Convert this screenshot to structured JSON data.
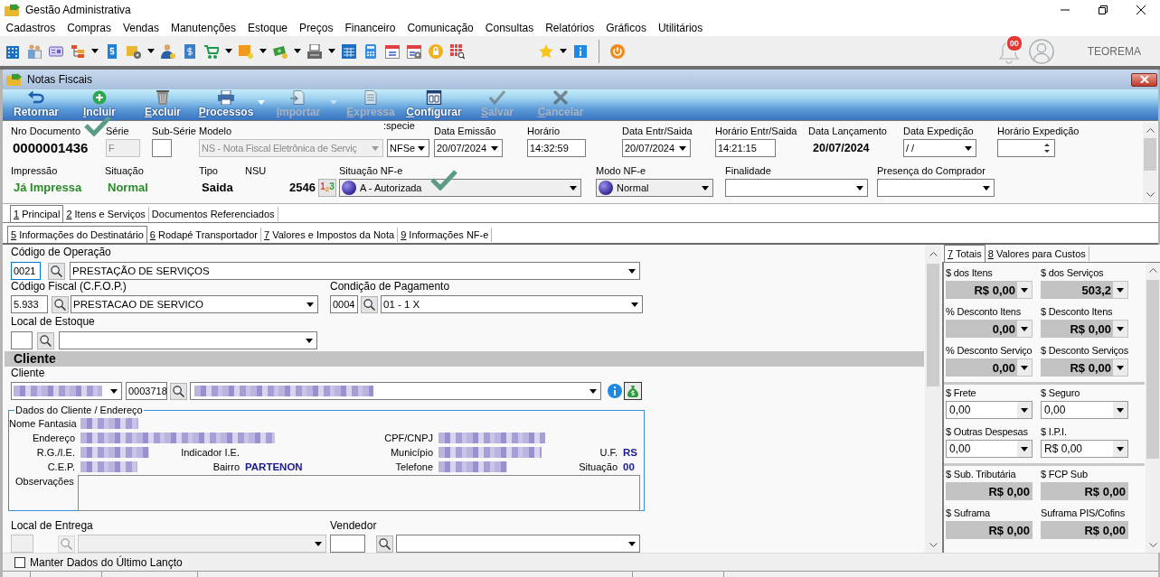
{
  "window": {
    "title": "Gestão Administrativa"
  },
  "menu": [
    "Cadastros",
    "Compras",
    "Vendas",
    "Manutenções",
    "Estoque",
    "Preços",
    "Financeiro",
    "Comunicação",
    "Consultas",
    "Relatórios",
    "Gráficos",
    "Utilitários"
  ],
  "user": {
    "notifications": "00",
    "name": "TEOREMA"
  },
  "form_window": {
    "title": "Notas Fiscais"
  },
  "actions": [
    {
      "label": "Retornar",
      "hotkey": false,
      "disabled": false,
      "has_menu": false
    },
    {
      "label": "Incluir",
      "hotkey": true,
      "disabled": false,
      "has_menu": false
    },
    {
      "label": "Excluir",
      "hotkey": true,
      "disabled": false,
      "has_menu": false
    },
    {
      "label": "Processos",
      "hotkey": true,
      "disabled": false,
      "has_menu": true
    },
    {
      "label": "Importar",
      "hotkey": true,
      "disabled": true,
      "has_menu": true
    },
    {
      "label": "Expressa",
      "hotkey": true,
      "disabled": true,
      "has_menu": false
    },
    {
      "label": "Configurar",
      "hotkey": true,
      "disabled": false,
      "has_menu": false
    },
    {
      "label": "Salvar",
      "hotkey": true,
      "disabled": true,
      "has_menu": false
    },
    {
      "label": "Cancelar",
      "hotkey": true,
      "disabled": true,
      "has_menu": false
    }
  ],
  "header": {
    "nro_documento": {
      "label": "Nro Documento",
      "value": "0000001436"
    },
    "serie": {
      "label": "Série",
      "value": "F",
      "disabled": true
    },
    "sub_serie": {
      "label": "Sub-Série",
      "disabled": false
    },
    "modelo": {
      "label": "Modelo",
      "value": "NS - Nota Fiscal Eletrônica de Serviç",
      "disabled": true
    },
    "especie": {
      "label": ":specie",
      "value": "NFSe"
    },
    "data_emissao": {
      "label": "Data Emissão",
      "value": "20/07/2024"
    },
    "horario": {
      "label": "Horário",
      "value": "14:32:59"
    },
    "data_entr_saida": {
      "label": "Data Entr/Saida",
      "value": "20/07/2024"
    },
    "horario_entr_saida": {
      "label": "Horário Entr/Saida",
      "value": "14:21:15"
    },
    "data_lancamento": {
      "label": "Data Lançamento",
      "value": "20/07/2024"
    },
    "data_expedicao": {
      "label": "Data Expedição",
      "value": "/ /"
    },
    "horario_expedicao": {
      "label": "Horário Expedição"
    },
    "impressao": {
      "label": "Impressão",
      "value": "Já Impressa"
    },
    "situacao": {
      "label": "Situação",
      "value": "Normal"
    },
    "tipo": {
      "label": "Tipo",
      "value": "Saida"
    },
    "nsu": {
      "label": "NSU",
      "value": "2546",
      "button": "1$_{2}$3"
    },
    "situacao_nfe": {
      "label": "Situação NF-e",
      "value": "A - Autorizada"
    },
    "modo_nfe": {
      "label": "Modo NF-e",
      "value": "Normal"
    },
    "finalidade": {
      "label": "Finalidade"
    },
    "presenca_comprador": {
      "label": "Presença do Comprador"
    }
  },
  "tabs": [
    {
      "label": "1 Principal",
      "selected": true,
      "hotkey": true
    },
    {
      "label": "2 Itens e Serviços",
      "selected": false,
      "hotkey": true
    },
    {
      "label": "Documentos Referenciados",
      "selected": false,
      "hotkey": false
    }
  ],
  "subtabs": [
    {
      "label": "5 Informações do Destinatário",
      "selected": true,
      "hotkey": true
    },
    {
      "label": "6 Rodapé Transportador",
      "selected": false,
      "hotkey": true
    },
    {
      "label": "7 Valores e Impostos da Nota",
      "selected": false,
      "hotkey": true
    },
    {
      "label": "9 Informações NF-e",
      "selected": false,
      "hotkey": true
    }
  ],
  "operacao": {
    "label": "Código de Operação",
    "code": "0021",
    "description": "PRESTAÇÃO DE SERVIÇOS"
  },
  "cfop": {
    "label": "Código Fiscal (C.F.O.P.)",
    "code": "5.933",
    "description": "PRESTACAO DE SERVICO"
  },
  "pagamento": {
    "label": "Condição de Pagamento",
    "code": "0004",
    "description": "01 - 1 X"
  },
  "local_estoque": {
    "label": "Local de Estoque"
  },
  "cliente_section": {
    "title": "Cliente"
  },
  "cliente": {
    "label": "Cliente",
    "type_redacted": true,
    "code": "0003718",
    "name_redacted": true
  },
  "client_data": {
    "title": "Dados do Cliente / Endereço",
    "nome_fantasia": {
      "label": "Nome Fantasia",
      "redacted": true
    },
    "endereco": {
      "label": "Endereço",
      "redacted": true
    },
    "cpf_cnpj": {
      "label": "CPF/CNPJ",
      "redacted": true
    },
    "rg_ie": {
      "label": "R.G./I.E.",
      "redacted": true
    },
    "indicador_ie": {
      "label": "Indicador I.E."
    },
    "municipio": {
      "label": "Município",
      "redacted": true
    },
    "uf": {
      "label": "U.F.",
      "value": "RS"
    },
    "cep": {
      "label": "C.E.P.",
      "redacted": true
    },
    "bairro": {
      "label": "Bairro",
      "value": "PARTENON"
    },
    "telefone": {
      "label": "Telefone",
      "redacted": true
    },
    "situacao": {
      "label": "Situação",
      "value": "00"
    },
    "observacoes": {
      "label": "Observações"
    }
  },
  "local_entrega": {
    "label": "Local de Entrega",
    "disabled": true
  },
  "vendedor": {
    "label": "Vendedor",
    "disabled": false
  },
  "totals": {
    "tabs": [
      {
        "label": "7 Totais",
        "selected": true,
        "hotkey": true
      },
      {
        "label": "8 Valores para Custos",
        "selected": false,
        "hotkey": true
      }
    ],
    "groups": [
      [
        {
          "label": "$ dos Itens",
          "value": "R$ 0,00",
          "readonly": true,
          "has_menu": true
        },
        {
          "label": "$ dos Serviços",
          "value": "503,2",
          "readonly": true,
          "has_menu": true
        },
        {
          "label": "% Desconto Itens",
          "value": "0,00",
          "readonly": true,
          "has_menu": true
        },
        {
          "label": "$ Desconto Itens",
          "value": "R$ 0,00",
          "readonly": true,
          "has_menu": true
        },
        {
          "label": "% Desconto Serviço",
          "value": "0,00",
          "readonly": true,
          "has_menu": true
        },
        {
          "label": "$ Desconto Serviços",
          "value": "R$ 0,00",
          "readonly": true,
          "has_menu": true
        }
      ],
      [
        {
          "label": "$ Frete",
          "value": "0,00",
          "readonly": false,
          "has_menu": true
        },
        {
          "label": "$ Seguro",
          "value": "0,00",
          "readonly": false,
          "has_menu": true
        },
        {
          "label": "$ Outras Despesas",
          "value": "0,00",
          "readonly": false,
          "has_menu": true
        },
        {
          "label": "$ I.P.I.",
          "value": "R$ 0,00",
          "readonly": false,
          "has_menu": true
        }
      ],
      [
        {
          "label": "$ Sub. Tributária",
          "value": "R$ 0,00",
          "readonly": true,
          "has_menu": false
        },
        {
          "label": "$ FCP Sub",
          "value": "R$ 0,00",
          "readonly": true,
          "has_menu": false
        },
        {
          "label": "$ Suframa",
          "value": "R$ 0,00",
          "readonly": true,
          "has_menu": false
        },
        {
          "label": "Suframa PIS/Cofins",
          "value": "R$ 0,00",
          "readonly": true,
          "has_menu": false
        }
      ]
    ]
  },
  "footer": {
    "keep_last": {
      "label": "Manter Dados do Último Lançto",
      "checked": false
    }
  }
}
